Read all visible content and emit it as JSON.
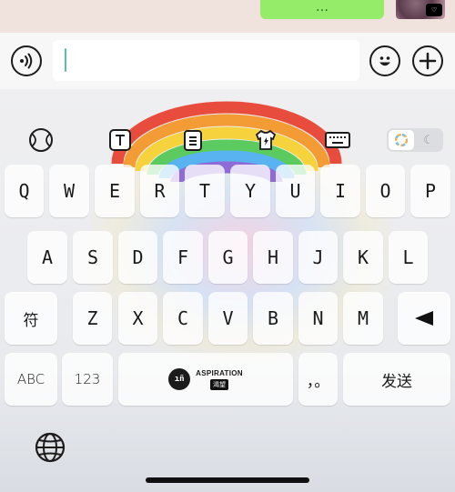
{
  "chat": {
    "last_message": "…",
    "avatar_badge": "♡"
  },
  "input_bar": {
    "voice_icon": "voice-input-icon",
    "emoji_icon": "emoji-icon",
    "plus_icon": "plus-icon",
    "text_value": "",
    "placeholder": ""
  },
  "keyboard": {
    "toolbar": {
      "icons": [
        "tennis-ball-icon",
        "text-icon",
        "clipboard-icon",
        "tshirt-theme-icon",
        "keyboard-icon"
      ],
      "mode": "light"
    },
    "rows": {
      "row1": [
        "Q",
        "W",
        "E",
        "R",
        "T",
        "Y",
        "U",
        "I",
        "O",
        "P"
      ],
      "row2": [
        "A",
        "S",
        "D",
        "F",
        "G",
        "H",
        "J",
        "K",
        "L"
      ],
      "row3": [
        "Z",
        "X",
        "C",
        "V",
        "B",
        "N",
        "M"
      ]
    },
    "symbol_key": "符",
    "abc_key": "ABC",
    "num_key": "123",
    "punct_key": "，。",
    "send_key": "发送",
    "space_brand": {
      "name": "ASPIRATION",
      "sub": "渴望",
      "logo": "ıñ"
    },
    "accent_colors": [
      "#e84c3d",
      "#f39c35",
      "#f6d23c",
      "#5ccb5f",
      "#58b3f0",
      "#8e6bd6"
    ]
  }
}
